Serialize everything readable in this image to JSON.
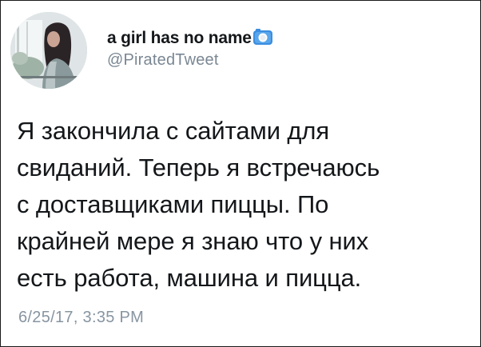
{
  "profile": {
    "display_name": "a girl has no name",
    "handle": "@PiratedTweet",
    "avatar_icon": "profile-photo",
    "badge_icon": "camera-emoji-icon"
  },
  "tweet": {
    "lines": [
      "Я закончила с сайтами для",
      "свиданий. Теперь я встречаюсь",
      "с доставщиками пиццы. По",
      "крайней мере я знаю что у них",
      "есть работа, машина и пицца."
    ],
    "timestamp": "6/25/17, 3:35 PM"
  },
  "colors": {
    "text": "#14171a",
    "secondary": "#7a8793",
    "badge_blue": "#3b8ee0",
    "frame": "#1a1a1a"
  }
}
